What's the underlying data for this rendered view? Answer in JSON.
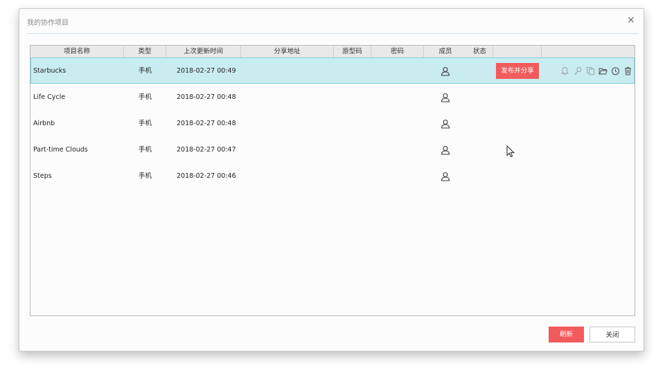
{
  "dialog": {
    "title": "我的协作项目",
    "close_glyph": "×"
  },
  "table": {
    "headers": [
      "项目名称",
      "类型",
      "上次更新时间",
      "分享地址",
      "原型码",
      "密码",
      "成员",
      "状态",
      "",
      ""
    ],
    "rows": [
      {
        "name": "Starbucks",
        "type": "手机",
        "updated": "2018-02-27 00:49",
        "selected": true
      },
      {
        "name": "Life Cycle",
        "type": "手机",
        "updated": "2018-02-27 00:48",
        "selected": false
      },
      {
        "name": "Airbnb",
        "type": "手机",
        "updated": "2018-02-27 00:48",
        "selected": false
      },
      {
        "name": "Part-time Clouds",
        "type": "手机",
        "updated": "2018-02-27 00:47",
        "selected": false
      },
      {
        "name": "Steps",
        "type": "手机",
        "updated": "2018-02-27 00:46",
        "selected": false
      }
    ],
    "publish_label": "发布并分享",
    "row_actions": [
      "bell-icon",
      "key-icon",
      "copy-icon",
      "folder-open-icon",
      "clock-icon",
      "trash-icon"
    ]
  },
  "footer": {
    "refresh_label": "刷新",
    "close_label": "关闭"
  },
  "colors": {
    "accent": "#f15b5b",
    "selected_row": "#c9ecf1",
    "selected_border": "#7ecfdb"
  }
}
